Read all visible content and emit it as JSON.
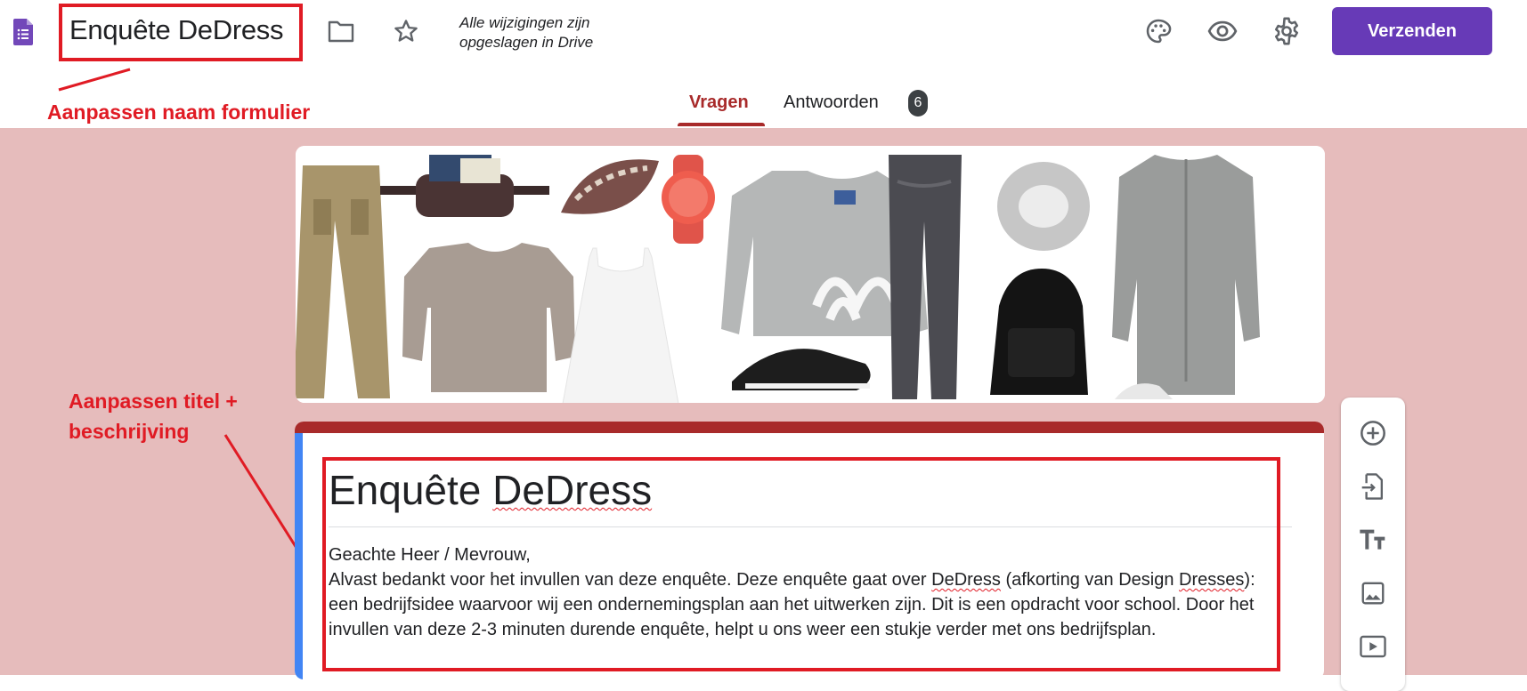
{
  "header": {
    "title": "Enquête DeDress",
    "save_status_line1": "Alle wijzigingen zijn",
    "save_status_line2": "opgeslagen in Drive",
    "send_label": "Verzenden",
    "icons": [
      "folder-icon",
      "star-icon",
      "palette-icon",
      "eye-icon",
      "gear-icon"
    ]
  },
  "tabs": [
    {
      "label": "Vragen",
      "active": true
    },
    {
      "label": "Antwoorden",
      "badge": "6"
    }
  ],
  "annotations": {
    "rename_form": "Aanpassen naam formulier",
    "edit_title_line1": "Aanpassen titel +",
    "edit_title_line2": "beschrijving"
  },
  "form": {
    "title": "Enquête DeDress",
    "description": {
      "greeting": "Geachte Heer / Mevrouw,",
      "line2_before": "Alvast bedankt voor het invullen van deze enquête. Deze enquête gaat over ",
      "brand": "DeDress",
      "line2_after": " (afkorting van Design",
      "dresses": "Dresses",
      "line3": "): een bedrijfsidee waarvoor wij een ondernemingsplan aan het uitwerken zijn. Dit is een opdracht voor school. Door het invullen van deze 2-3 minuten durende enquête, helpt u ons weer een stukje verder met ons bedrijfsplan."
    }
  },
  "side_toolbar": [
    "add-question-icon",
    "import-questions-icon",
    "add-title-icon",
    "add-image-icon",
    "add-video-icon"
  ],
  "colors": {
    "accent": "#673ab7",
    "theme": "#a82a2a",
    "background": "#e6bcbc",
    "annotation": "#e01b24"
  }
}
